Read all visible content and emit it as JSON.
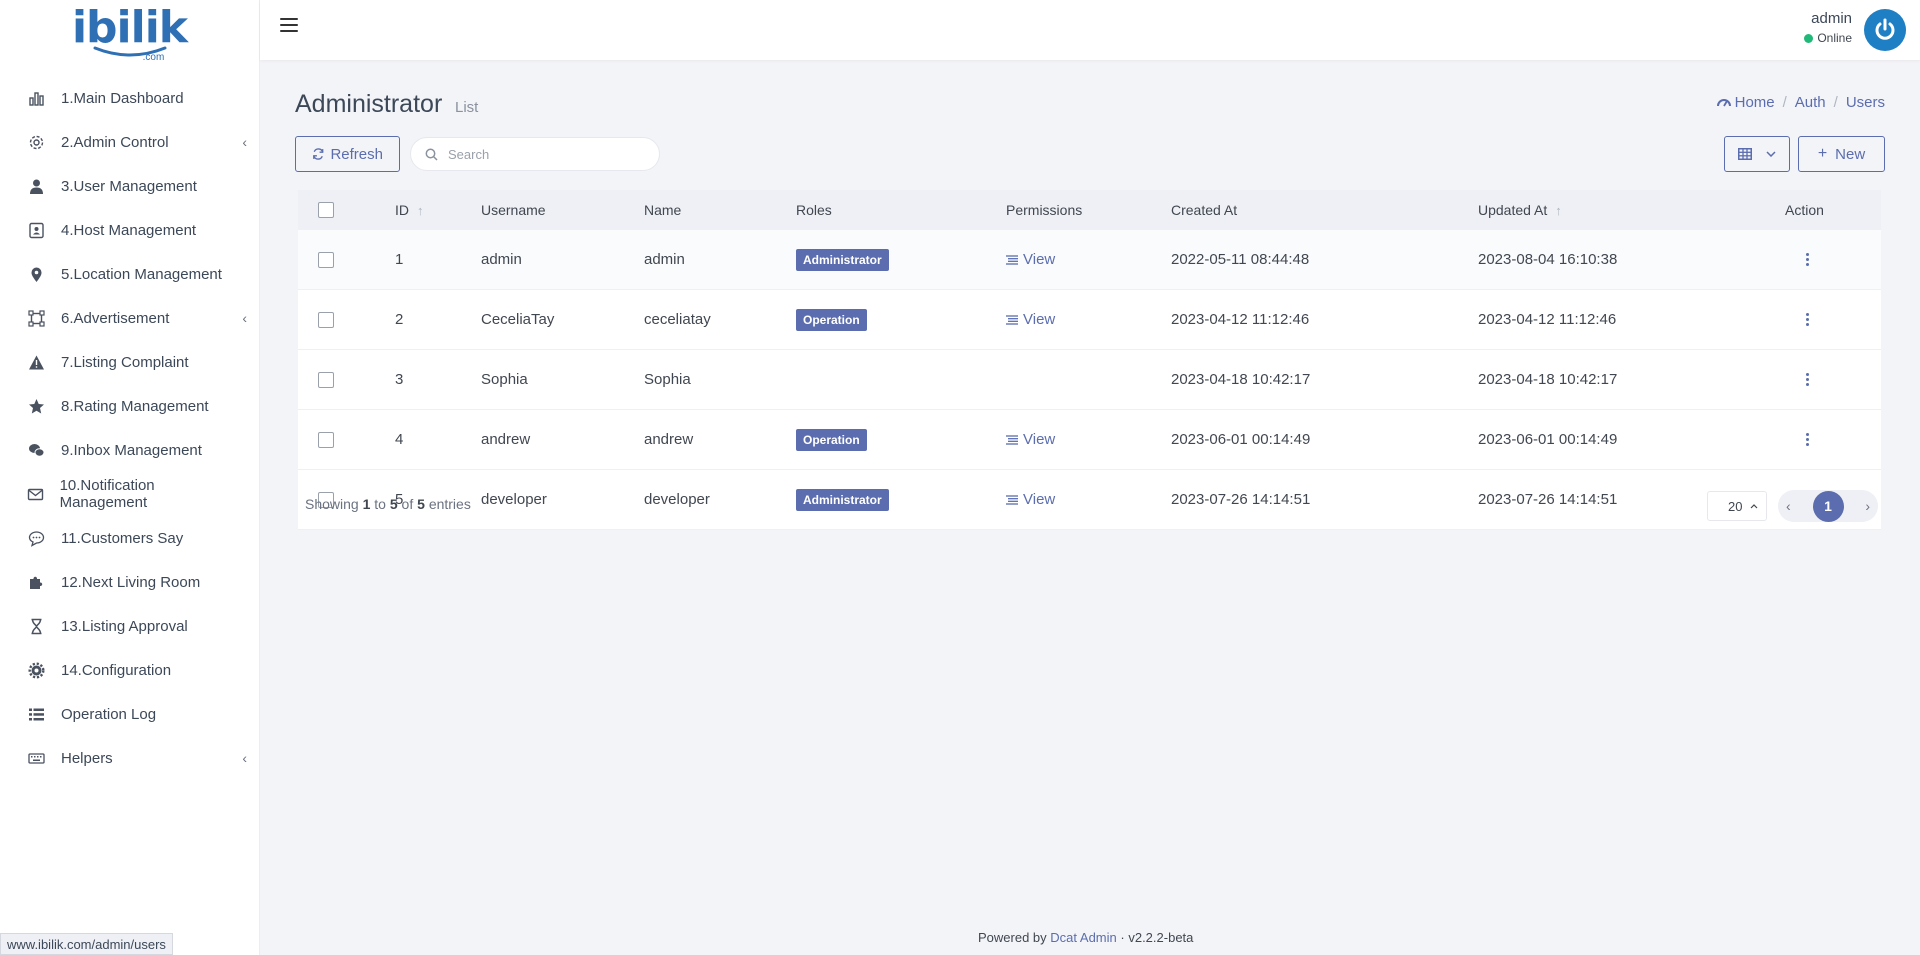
{
  "brand": {
    "logo_text": "ibilik",
    "logo_suffix": ".com",
    "color": "#2f6fb4"
  },
  "sidebar": {
    "items": [
      {
        "label": "1.Main Dashboard",
        "icon": "bar-chart-icon",
        "has_children": false
      },
      {
        "label": "2.Admin Control",
        "icon": "gear-icon",
        "has_children": true
      },
      {
        "label": "3.User Management",
        "icon": "user-icon",
        "has_children": false
      },
      {
        "label": "4.Host Management",
        "icon": "contact-card-icon",
        "has_children": false
      },
      {
        "label": "5.Location Management",
        "icon": "map-pin-icon",
        "has_children": false
      },
      {
        "label": "6.Advertisement",
        "icon": "crop-icon",
        "has_children": true
      },
      {
        "label": "7.Listing Complaint",
        "icon": "warning-icon",
        "has_children": false
      },
      {
        "label": "8.Rating Management",
        "icon": "star-icon",
        "has_children": false
      },
      {
        "label": "9.Inbox Management",
        "icon": "chat-bubbles-icon",
        "has_children": false
      },
      {
        "label": "10.Notification Management",
        "icon": "envelope-icon",
        "has_children": false
      },
      {
        "label": "11.Customers Say",
        "icon": "comment-icon",
        "has_children": false
      },
      {
        "label": "12.Next Living Room",
        "icon": "puzzle-icon",
        "has_children": false
      },
      {
        "label": "13.Listing Approval",
        "icon": "hourglass-icon",
        "has_children": false
      },
      {
        "label": "14.Configuration",
        "icon": "cog-icon",
        "has_children": false
      },
      {
        "label": "Operation Log",
        "icon": "list-icon",
        "has_children": false
      },
      {
        "label": "Helpers",
        "icon": "keyboard-icon",
        "has_children": true
      }
    ]
  },
  "header": {
    "user_name": "admin",
    "user_status": "Online"
  },
  "page": {
    "title": "Administrator",
    "subtitle": "List",
    "breadcrumb": {
      "home": "Home",
      "auth": "Auth",
      "users": "Users"
    }
  },
  "toolbar": {
    "refresh_label": "Refresh",
    "search_placeholder": "Search",
    "new_label": "New"
  },
  "table": {
    "headers": {
      "id": "ID",
      "username": "Username",
      "name": "Name",
      "roles": "Roles",
      "permissions": "Permissions",
      "created_at": "Created At",
      "updated_at": "Updated At",
      "action": "Action"
    },
    "rows": [
      {
        "id": "1",
        "username": "admin",
        "name": "admin",
        "role": "Administrator",
        "permissions": "View",
        "created_at": "2022-05-11 08:44:48",
        "updated_at": "2023-08-04 16:10:38"
      },
      {
        "id": "2",
        "username": "CeceliaTay",
        "name": "ceceliatay",
        "role": "Operation",
        "permissions": "View",
        "created_at": "2023-04-12 11:12:46",
        "updated_at": "2023-04-12 11:12:46"
      },
      {
        "id": "3",
        "username": "Sophia",
        "name": "Sophia",
        "role": "",
        "permissions": "",
        "created_at": "2023-04-18 10:42:17",
        "updated_at": "2023-04-18 10:42:17"
      },
      {
        "id": "4",
        "username": "andrew",
        "name": "andrew",
        "role": "Operation",
        "permissions": "View",
        "created_at": "2023-06-01 00:14:49",
        "updated_at": "2023-06-01 00:14:49"
      },
      {
        "id": "5",
        "username": "developer",
        "name": "developer",
        "role": "Administrator",
        "permissions": "View",
        "created_at": "2023-07-26 14:14:51",
        "updated_at": "2023-07-26 14:14:51"
      }
    ]
  },
  "footer": {
    "showing_prefix": "Showing",
    "from": "1",
    "to_word": "to",
    "to": "5",
    "of_word": "of",
    "total": "5",
    "entries_word": "entries",
    "per_page": "20",
    "current_page": "1",
    "powered_prefix": "Powered by",
    "powered_link": "Dcat Admin",
    "version": "v2.2.2-beta"
  },
  "statusbar": {
    "url": "www.ibilik.com/admin/users"
  },
  "colors": {
    "accent": "#5b6dae",
    "online": "#21b978",
    "avatar": "#1f7fc4"
  }
}
